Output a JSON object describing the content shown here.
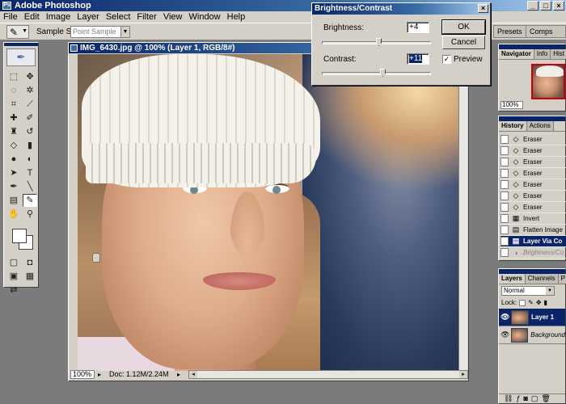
{
  "app": {
    "title": "Adobe Photoshop"
  },
  "menu": [
    "File",
    "Edit",
    "Image",
    "Layer",
    "Select",
    "Filter",
    "View",
    "Window",
    "Help"
  ],
  "options": {
    "sample_size_label": "Sample Size:",
    "sample_size_value": "Point Sample"
  },
  "palette_well": {
    "presets": "Presets",
    "comps": "Comps"
  },
  "document": {
    "title": "IMG_6430.jpg @ 100% (Layer 1, RGB/8#)",
    "zoom": "100%",
    "doc_info": "Doc: 1.12M/2.24M"
  },
  "dialog": {
    "title": "Brightness/Contrast",
    "brightness_label": "Brightness:",
    "brightness_value": "+4",
    "brightness_level": 0.52,
    "contrast_label": "Contrast:",
    "contrast_value": "+11",
    "contrast_level": 0.555,
    "ok_label": "OK",
    "cancel_label": "Cancel",
    "preview_label": "Preview",
    "preview_checked": true
  },
  "navigator": {
    "tabs": [
      "Navigator",
      "Info",
      "Hist"
    ],
    "zoom": "100%"
  },
  "history": {
    "tabs": [
      "History",
      "Actions"
    ],
    "items": [
      {
        "label": "Eraser",
        "icon": "eraser-icon"
      },
      {
        "label": "Eraser",
        "icon": "eraser-icon"
      },
      {
        "label": "Eraser",
        "icon": "eraser-icon"
      },
      {
        "label": "Eraser",
        "icon": "eraser-icon"
      },
      {
        "label": "Eraser",
        "icon": "eraser-icon"
      },
      {
        "label": "Eraser",
        "icon": "eraser-icon"
      },
      {
        "label": "Eraser",
        "icon": "eraser-icon"
      },
      {
        "label": "Invert",
        "icon": "invert-icon"
      },
      {
        "label": "Flatten Image",
        "icon": "flatten-icon"
      },
      {
        "label": "Layer Via Co",
        "icon": "layer-icon"
      },
      {
        "label": "Brightness/Co",
        "icon": "adjust-icon"
      }
    ]
  },
  "layers": {
    "tabs": [
      "Layers",
      "Channels",
      "P"
    ],
    "blend_mode": "Normal",
    "lock_label": "Lock:",
    "items": [
      {
        "label": "Layer 1"
      },
      {
        "label": "Background"
      }
    ]
  },
  "colors": {
    "title_bar": "#0a246a",
    "chrome": "#d4d0c8",
    "workspace": "#7b7b7b"
  }
}
